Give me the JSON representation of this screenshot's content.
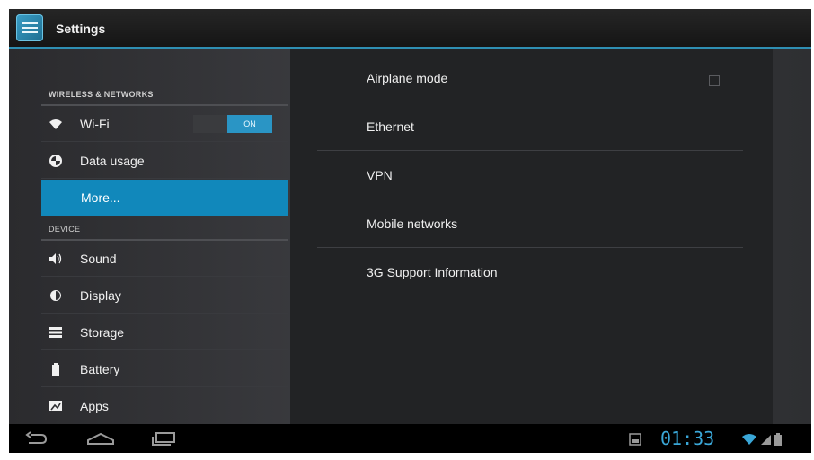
{
  "app": {
    "title": "Settings"
  },
  "sidebar": {
    "section1": "WIRELESS & NETWORKS",
    "section2": "DEVICE",
    "wifi_toggle": "ON",
    "items": [
      {
        "label": "Wi-Fi",
        "icon": "wifi-icon"
      },
      {
        "label": "Data usage",
        "icon": "data-usage-icon"
      },
      {
        "label": "More...",
        "icon": ""
      },
      {
        "label": "Sound",
        "icon": "speaker-icon"
      },
      {
        "label": "Display",
        "icon": "display-brightness-icon"
      },
      {
        "label": "Storage",
        "icon": "storage-icon"
      },
      {
        "label": "Battery",
        "icon": "battery-icon"
      },
      {
        "label": "Apps",
        "icon": "apps-icon"
      }
    ]
  },
  "main": {
    "options": [
      {
        "label": "Airplane mode",
        "checked": false
      },
      {
        "label": "Ethernet"
      },
      {
        "label": "VPN"
      },
      {
        "label": "Mobile networks"
      },
      {
        "label": "3G Support Information"
      }
    ]
  },
  "statusbar": {
    "time": "01:33"
  },
  "colors": {
    "accent": "#1188bb",
    "clock": "#3aa7d8"
  }
}
